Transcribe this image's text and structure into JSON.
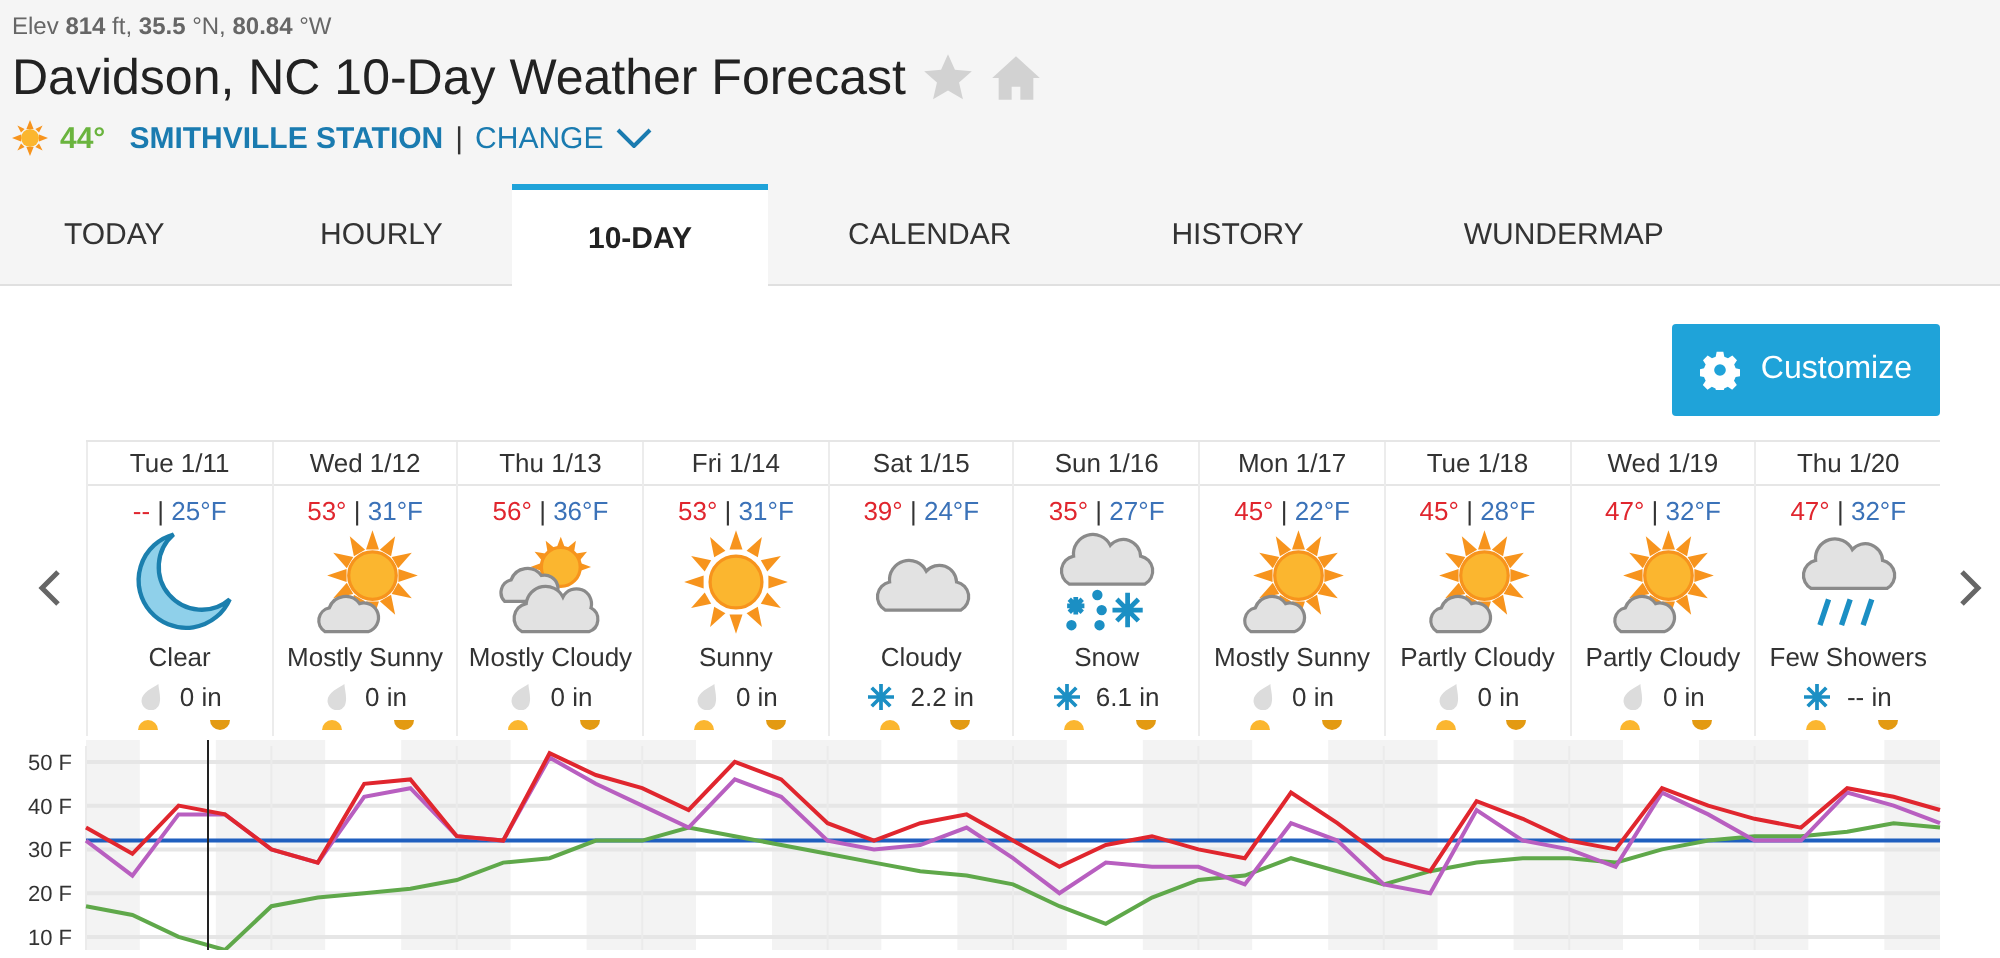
{
  "location_meta": "Elev **814** ft, **35.5** °N, **80.84** °W",
  "title": "Davidson, NC 10-Day Weather Forecast",
  "station": {
    "temp": "44°",
    "name": "SMITHVILLE STATION",
    "separator": "|",
    "change": "CHANGE"
  },
  "tabs": [
    {
      "label": "TODAY",
      "selected": false
    },
    {
      "label": "HOURLY",
      "selected": false
    },
    {
      "label": "10-DAY",
      "selected": true
    },
    {
      "label": "CALENDAR",
      "selected": false
    },
    {
      "label": "HISTORY",
      "selected": false
    },
    {
      "label": "WUNDERMAP",
      "selected": false
    }
  ],
  "customize_button": "Customize",
  "days": [
    {
      "date": "Tue 1/11",
      "high": "--",
      "separator": "|",
      "low": "25°F",
      "kind": "moon",
      "condition": "Clear",
      "precip": {
        "kind": "drop",
        "amount": "0 in"
      }
    },
    {
      "date": "Wed 1/12",
      "high": "53°",
      "separator": "|",
      "low": "31°F",
      "kind": "sun-cloud",
      "condition": "Mostly Sunny",
      "precip": {
        "kind": "drop",
        "amount": "0 in"
      }
    },
    {
      "date": "Thu 1/13",
      "high": "56°",
      "separator": "|",
      "low": "36°F",
      "kind": "clouds-sun",
      "condition": "Mostly Cloudy",
      "precip": {
        "kind": "drop",
        "amount": "0 in"
      }
    },
    {
      "date": "Fri 1/14",
      "high": "53°",
      "separator": "|",
      "low": "31°F",
      "kind": "sun",
      "condition": "Sunny",
      "precip": {
        "kind": "drop",
        "amount": "0 in"
      }
    },
    {
      "date": "Sat 1/15",
      "high": "39°",
      "separator": "|",
      "low": "24°F",
      "kind": "cloud",
      "condition": "Cloudy",
      "precip": {
        "kind": "flake",
        "amount": "2.2 in"
      }
    },
    {
      "date": "Sun 1/16",
      "high": "35°",
      "separator": "|",
      "low": "27°F",
      "kind": "snow",
      "condition": "Snow",
      "precip": {
        "kind": "flake",
        "amount": "6.1 in"
      }
    },
    {
      "date": "Mon 1/17",
      "high": "45°",
      "separator": "|",
      "low": "22°F",
      "kind": "sun-cloud",
      "condition": "Mostly Sunny",
      "precip": {
        "kind": "drop",
        "amount": "0 in"
      }
    },
    {
      "date": "Tue 1/18",
      "high": "45°",
      "separator": "|",
      "low": "28°F",
      "kind": "sun-cloud",
      "condition": "Partly Cloudy",
      "precip": {
        "kind": "drop",
        "amount": "0 in"
      }
    },
    {
      "date": "Wed 1/19",
      "high": "47°",
      "separator": "|",
      "low": "32°F",
      "kind": "sun-cloud",
      "condition": "Partly Cloudy",
      "precip": {
        "kind": "drop",
        "amount": "0 in"
      }
    },
    {
      "date": "Thu 1/20",
      "high": "47°",
      "separator": "|",
      "low": "32°F",
      "kind": "rain",
      "condition": "Few Showers",
      "precip": {
        "kind": "flake",
        "amount": "-- in"
      }
    }
  ],
  "chart_data": {
    "type": "line",
    "ylim": [
      7,
      55
    ],
    "grid": true,
    "yticks": [
      {
        "value": 10,
        "label": "10 F"
      },
      {
        "value": 20,
        "label": "20 F"
      },
      {
        "value": 30,
        "label": "30 F"
      },
      {
        "value": 40,
        "label": "40 F"
      },
      {
        "value": 50,
        "label": "50 F"
      }
    ],
    "series": [
      {
        "color": "#1f5fbf",
        "values": [
          32,
          32,
          32,
          32,
          32,
          32,
          32,
          32,
          32,
          32,
          32,
          32,
          32,
          32,
          32,
          32,
          32,
          32,
          32,
          32,
          32,
          32,
          32,
          32,
          32,
          32,
          32,
          32,
          32,
          32,
          32,
          32,
          32,
          32,
          32,
          32,
          32,
          32,
          32,
          32,
          32
        ]
      },
      {
        "color": "#5fa84a",
        "values": [
          17,
          15,
          10,
          7,
          17,
          19,
          20,
          21,
          23,
          27,
          28,
          32,
          32,
          35,
          33,
          31,
          29,
          27,
          25,
          24,
          22,
          17,
          13,
          19,
          23,
          24,
          28,
          25,
          22,
          25,
          27,
          28,
          28,
          27,
          30,
          32,
          33,
          33,
          34,
          36,
          35
        ]
      },
      {
        "color": "#b85fc0",
        "values": [
          32,
          24,
          38,
          38,
          30,
          27,
          42,
          44,
          33,
          32,
          51,
          45,
          40,
          35,
          46,
          42,
          32,
          30,
          31,
          35,
          28,
          20,
          27,
          26,
          26,
          22,
          36,
          32,
          22,
          20,
          39,
          32,
          30,
          26,
          43,
          38,
          32,
          32,
          43,
          40,
          36
        ]
      },
      {
        "color": "#e0262e",
        "values": [
          35,
          29,
          40,
          38,
          30,
          27,
          45,
          46,
          33,
          32,
          52,
          47,
          44,
          39,
          50,
          46,
          36,
          32,
          36,
          38,
          32,
          26,
          31,
          33,
          30,
          28,
          43,
          36,
          28,
          25,
          41,
          37,
          32,
          30,
          44,
          40,
          37,
          35,
          44,
          42,
          39
        ]
      }
    ]
  }
}
